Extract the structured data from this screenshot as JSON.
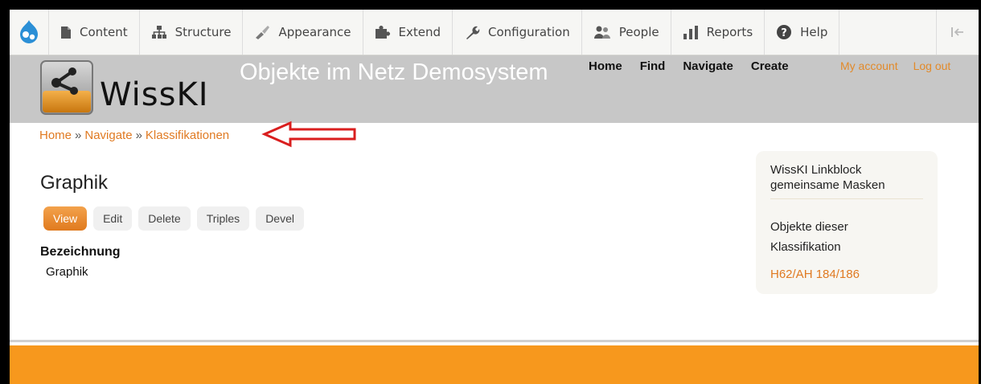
{
  "toolbar": {
    "items": [
      {
        "label": "Content",
        "icon": "page-icon"
      },
      {
        "label": "Structure",
        "icon": "sitemap-icon"
      },
      {
        "label": "Appearance",
        "icon": "brush-icon"
      },
      {
        "label": "Extend",
        "icon": "puzzle-icon"
      },
      {
        "label": "Configuration",
        "icon": "wrench-icon"
      },
      {
        "label": "People",
        "icon": "people-icon"
      },
      {
        "label": "Reports",
        "icon": "bar-chart-icon"
      },
      {
        "label": "Help",
        "icon": "help-icon"
      }
    ]
  },
  "site": {
    "name": "WissKI",
    "slogan": "Objekte im Netz Demosystem"
  },
  "main_menu": [
    "Home",
    "Find",
    "Navigate",
    "Create"
  ],
  "account_menu": [
    "My account",
    "Log out"
  ],
  "breadcrumb": {
    "items": [
      "Home",
      "Navigate",
      "Klassifikationen"
    ],
    "separator": "»"
  },
  "page": {
    "title": "Graphik",
    "tabs": [
      "View",
      "Edit",
      "Delete",
      "Triples",
      "Devel"
    ],
    "active_tab": "View",
    "field_label": "Bezeichnung",
    "field_value": "Graphik"
  },
  "sidebar_block": {
    "title": "WissKI Linkblock gemeinsame Masken",
    "subtitle": "Objekte dieser Klassifikation",
    "link": "H62/AH 184/186"
  },
  "colors": {
    "accent": "#e07a22",
    "footer": "#f7981d",
    "drupal_blue": "#2b8fd6",
    "arrow": "#d91e1e"
  }
}
